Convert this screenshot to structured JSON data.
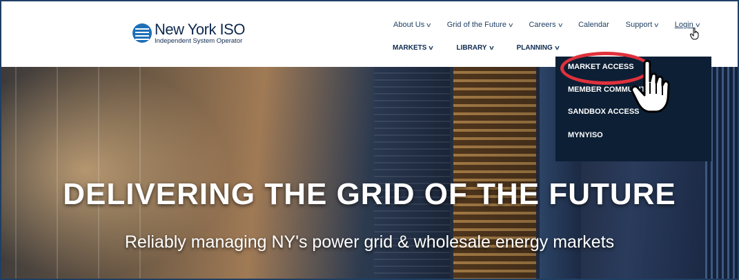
{
  "logo": {
    "name": "New York ISO",
    "subtitle": "Independent System Operator"
  },
  "top_nav": [
    {
      "label": "About Us",
      "has_dropdown": true
    },
    {
      "label": "Grid of the Future",
      "has_dropdown": true
    },
    {
      "label": "Careers",
      "has_dropdown": true
    },
    {
      "label": "Calendar",
      "has_dropdown": false
    },
    {
      "label": "Support",
      "has_dropdown": true
    },
    {
      "label": "Login",
      "has_dropdown": true
    }
  ],
  "main_nav": [
    {
      "label": "MARKETS"
    },
    {
      "label": "LIBRARY"
    },
    {
      "label": "PLANNING"
    }
  ],
  "login_menu": [
    {
      "label": "MARKET ACCESS"
    },
    {
      "label": "MEMBER COMMUNITY"
    },
    {
      "label": "SANDBOX ACCESS"
    },
    {
      "label": "MYNYISO"
    }
  ],
  "hero": {
    "title": "DELIVERING THE GRID OF THE FUTURE",
    "subtitle": "Reliably managing NY's power grid & wholesale energy markets"
  },
  "colors": {
    "navy": "#0d1f35",
    "brand_blue": "#1d6fb8",
    "highlight_red": "#e0313b"
  }
}
